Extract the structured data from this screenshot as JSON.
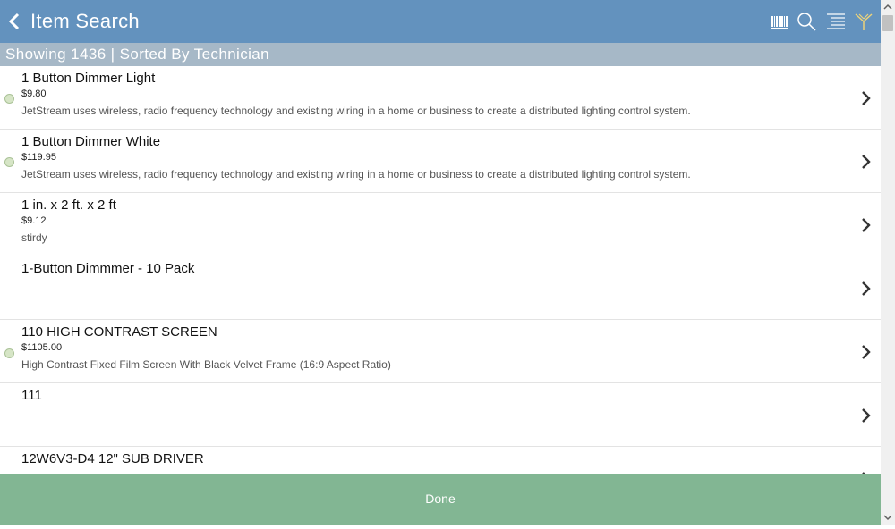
{
  "header": {
    "title": "Item Search",
    "icons": [
      "chevron-left-icon",
      "barcode-icon",
      "search-icon",
      "list-icon",
      "filter-tree-icon"
    ]
  },
  "subheader": {
    "text": "Showing 1436 | Sorted By Technician"
  },
  "items": [
    {
      "name": "1 Button Dimmer Light",
      "price": "$9.80",
      "description": "JetStream uses wireless, radio frequency technology and existing wiring in a home or business to create a distributed lighting control system.",
      "status": true
    },
    {
      "name": "1 Button Dimmer White",
      "price": "$119.95",
      "description": "JetStream uses wireless, radio frequency technology and existing wiring in a home or business to create a distributed lighting control system.",
      "status": true
    },
    {
      "name": "1 in. x 2 ft. x 2 ft",
      "price": "$9.12",
      "description": "stirdy",
      "status": false
    },
    {
      "name": "1-Button Dimmmer - 10 Pack",
      "price": "",
      "description": "",
      "status": false
    },
    {
      "name": "110 HIGH CONTRAST SCREEN",
      "price": "$1105.00",
      "description": "High Contrast Fixed Film Screen With Black Velvet Frame (16:9 Aspect Ratio)",
      "status": true
    },
    {
      "name": "111",
      "price": "",
      "description": "",
      "status": false
    },
    {
      "name": "12W6V3-D4 12\" SUB DRIVER",
      "price": "",
      "description": "",
      "status": false
    }
  ],
  "footer": {
    "done_label": "Done"
  },
  "colors": {
    "header_bg": "#6392be",
    "subheader_bg": "#a6b8c7",
    "done_bg": "#82b693",
    "status_dot": "#d6e5c6"
  }
}
